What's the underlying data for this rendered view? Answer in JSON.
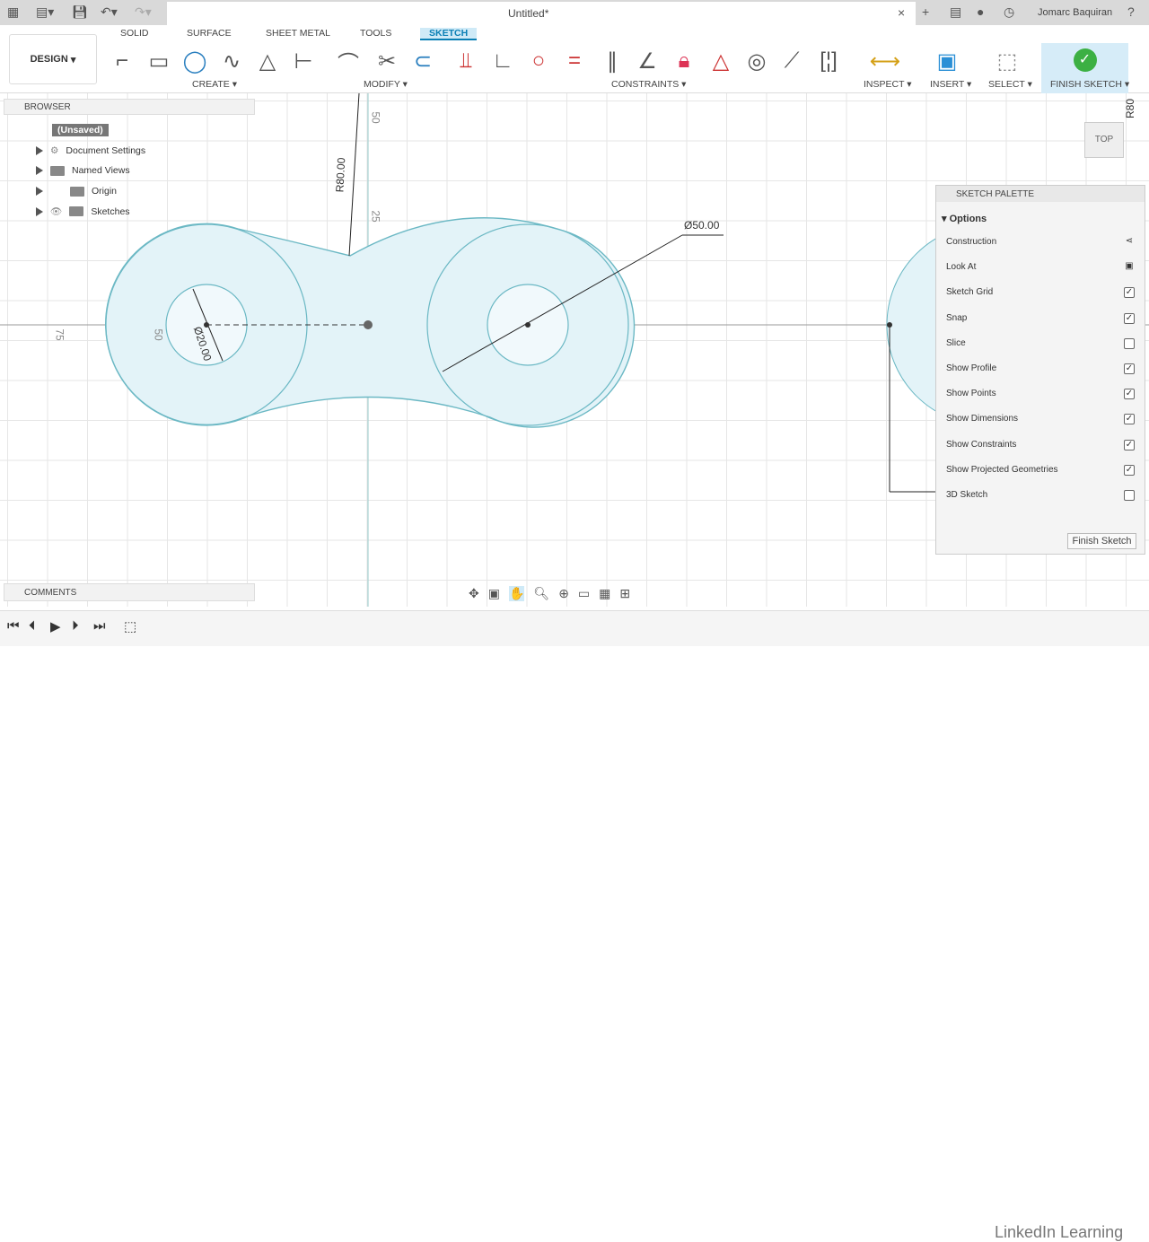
{
  "title": "Untitled*",
  "user": "Jomarc Baquiran",
  "workspace": "DESIGN",
  "tabs": [
    "SOLID",
    "SURFACE",
    "SHEET METAL",
    "TOOLS",
    "SKETCH"
  ],
  "groups": {
    "create": "CREATE",
    "modify": "MODIFY",
    "constraints": "CONSTRAINTS",
    "inspect": "INSPECT",
    "insert": "INSERT",
    "select": "SELECT",
    "finish": "FINISH SKETCH"
  },
  "browser": {
    "title": "BROWSER",
    "root": "(Unsaved)",
    "items": [
      "Document Settings",
      "Named Views",
      "Origin",
      "Sketches"
    ]
  },
  "comments": "COMMENTS",
  "viewcube": "TOP",
  "dimensions": {
    "r80": "R80.00",
    "d50": "Ø50.00",
    "d20": "Ø20.00",
    "ruler_50": "50",
    "ruler_25": "25",
    "ruler_75": "75",
    "ruler_50b": "50",
    "r80_right": "R80"
  },
  "palette": {
    "title": "SKETCH PALETTE",
    "section": "Options",
    "rows": [
      {
        "label": "Construction",
        "type": "icon"
      },
      {
        "label": "Look At",
        "type": "icon"
      },
      {
        "label": "Sketch Grid",
        "checked": true
      },
      {
        "label": "Snap",
        "checked": true
      },
      {
        "label": "Slice",
        "checked": false
      },
      {
        "label": "Show Profile",
        "checked": true
      },
      {
        "label": "Show Points",
        "checked": true
      },
      {
        "label": "Show Dimensions",
        "checked": true
      },
      {
        "label": "Show Constraints",
        "checked": true
      },
      {
        "label": "Show Projected Geometries",
        "checked": true
      },
      {
        "label": "3D Sketch",
        "checked": false
      }
    ],
    "finish_button": "Finish Sketch"
  },
  "watermark": "LinkedIn Learning"
}
